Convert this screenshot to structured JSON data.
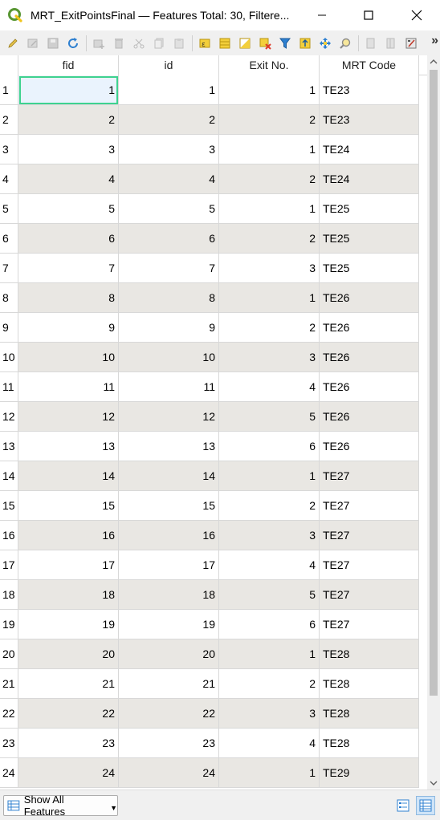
{
  "window": {
    "title": "MRT_ExitPointsFinal — Features Total: 30, Filtere..."
  },
  "toolbar": {
    "buttons": [
      "pencil-icon",
      "edit-multi-icon",
      "save-icon",
      "reload-icon",
      "add-feature-icon",
      "delete-icon",
      "cut-icon",
      "copy-icon",
      "paste-icon",
      "select-expression-icon",
      "select-all-icon",
      "invert-selection-icon",
      "deselect-icon",
      "filter-icon",
      "move-top-icon",
      "pan-map-icon",
      "zoom-map-icon",
      "new-field-icon",
      "delete-field-icon",
      "field-calculator-icon"
    ],
    "more_label": "»"
  },
  "table": {
    "columns": [
      "fid",
      "id",
      "Exit No.",
      "MRT Code"
    ],
    "rows": [
      {
        "n": "1",
        "fid": "1",
        "id": "1",
        "exit": "1",
        "code": "TE23"
      },
      {
        "n": "2",
        "fid": "2",
        "id": "2",
        "exit": "2",
        "code": "TE23"
      },
      {
        "n": "3",
        "fid": "3",
        "id": "3",
        "exit": "1",
        "code": "TE24"
      },
      {
        "n": "4",
        "fid": "4",
        "id": "4",
        "exit": "2",
        "code": "TE24"
      },
      {
        "n": "5",
        "fid": "5",
        "id": "5",
        "exit": "1",
        "code": "TE25"
      },
      {
        "n": "6",
        "fid": "6",
        "id": "6",
        "exit": "2",
        "code": "TE25"
      },
      {
        "n": "7",
        "fid": "7",
        "id": "7",
        "exit": "3",
        "code": "TE25"
      },
      {
        "n": "8",
        "fid": "8",
        "id": "8",
        "exit": "1",
        "code": "TE26"
      },
      {
        "n": "9",
        "fid": "9",
        "id": "9",
        "exit": "2",
        "code": "TE26"
      },
      {
        "n": "10",
        "fid": "10",
        "id": "10",
        "exit": "3",
        "code": "TE26"
      },
      {
        "n": "11",
        "fid": "11",
        "id": "11",
        "exit": "4",
        "code": "TE26"
      },
      {
        "n": "12",
        "fid": "12",
        "id": "12",
        "exit": "5",
        "code": "TE26"
      },
      {
        "n": "13",
        "fid": "13",
        "id": "13",
        "exit": "6",
        "code": "TE26"
      },
      {
        "n": "14",
        "fid": "14",
        "id": "14",
        "exit": "1",
        "code": "TE27"
      },
      {
        "n": "15",
        "fid": "15",
        "id": "15",
        "exit": "2",
        "code": "TE27"
      },
      {
        "n": "16",
        "fid": "16",
        "id": "16",
        "exit": "3",
        "code": "TE27"
      },
      {
        "n": "17",
        "fid": "17",
        "id": "17",
        "exit": "4",
        "code": "TE27"
      },
      {
        "n": "18",
        "fid": "18",
        "id": "18",
        "exit": "5",
        "code": "TE27"
      },
      {
        "n": "19",
        "fid": "19",
        "id": "19",
        "exit": "6",
        "code": "TE27"
      },
      {
        "n": "20",
        "fid": "20",
        "id": "20",
        "exit": "1",
        "code": "TE28"
      },
      {
        "n": "21",
        "fid": "21",
        "id": "21",
        "exit": "2",
        "code": "TE28"
      },
      {
        "n": "22",
        "fid": "22",
        "id": "22",
        "exit": "3",
        "code": "TE28"
      },
      {
        "n": "23",
        "fid": "23",
        "id": "23",
        "exit": "4",
        "code": "TE28"
      },
      {
        "n": "24",
        "fid": "24",
        "id": "24",
        "exit": "1",
        "code": "TE29"
      }
    ]
  },
  "bottom": {
    "show_features_label": "Show All Features"
  },
  "colors": {
    "selection_outline": "#3ed28f",
    "alt_row": "#e9e7e3",
    "qgis_green": "#589632",
    "qgis_yellow": "#f0c419"
  }
}
